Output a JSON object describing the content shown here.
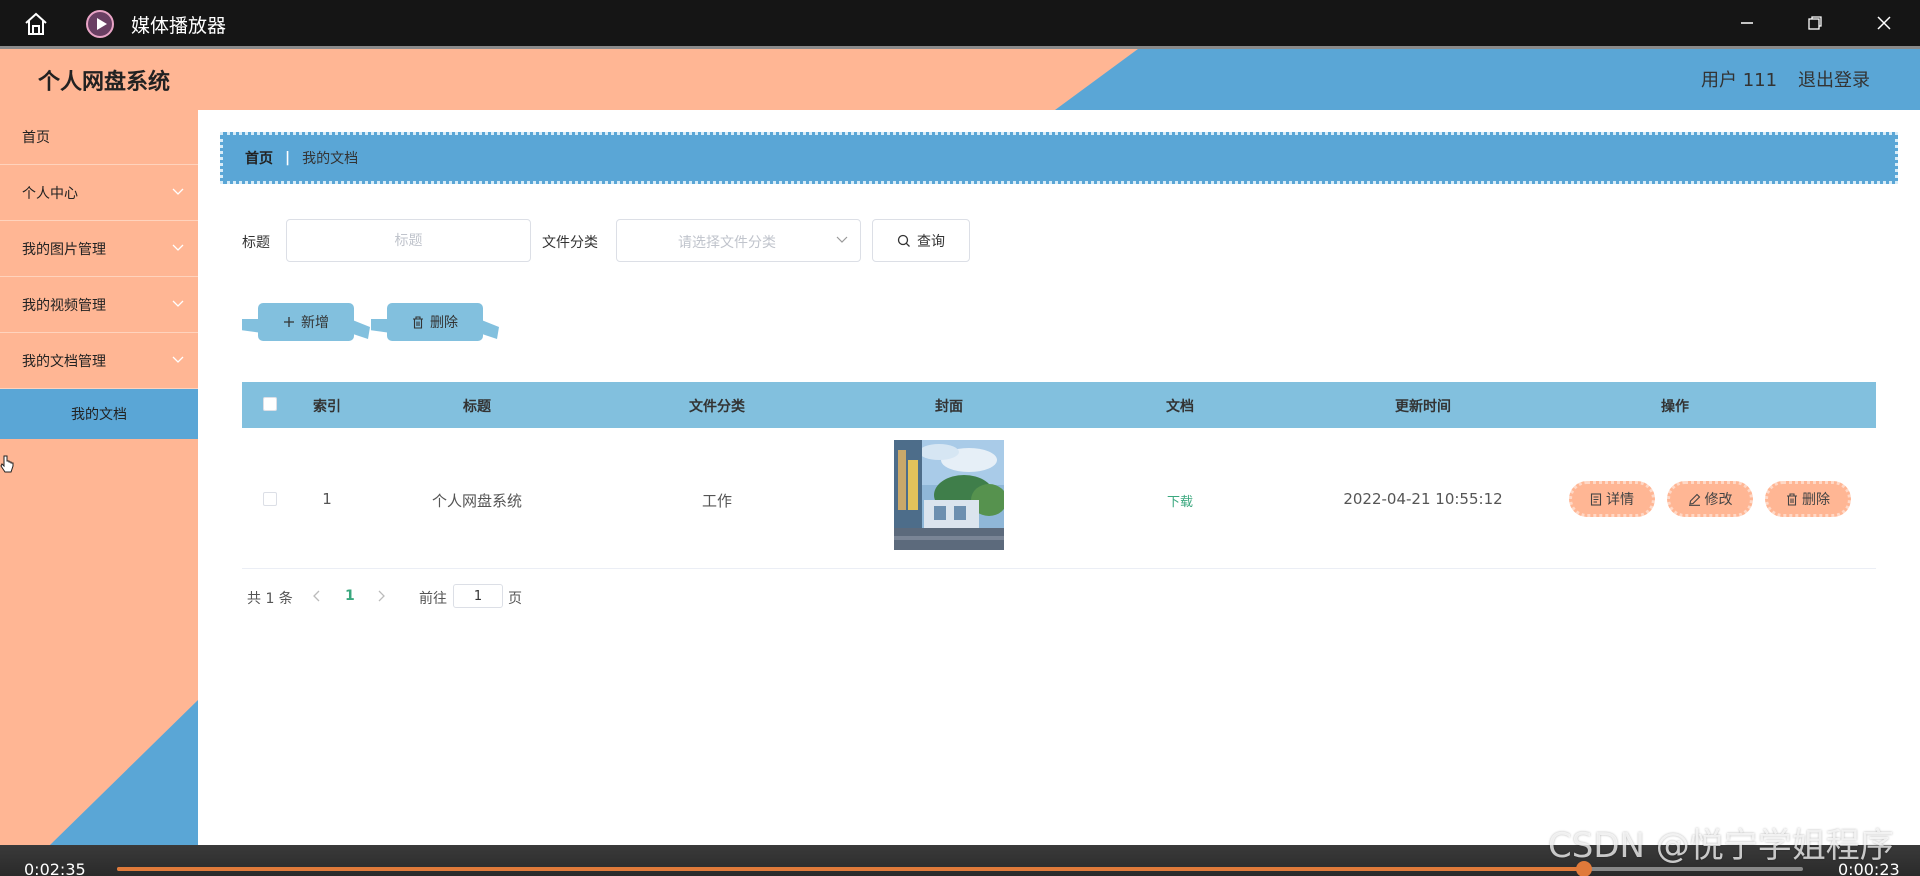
{
  "player": {
    "window_title": "媒体播放器",
    "elapsed": "0:02:35",
    "remaining": "0:00:23",
    "progress": 0.87,
    "watermark": "CSDN @悦宁学姐程序"
  },
  "header": {
    "app_title": "个人网盘系统",
    "user": "用户 111",
    "logout": "退出登录"
  },
  "sidebar": {
    "items": [
      {
        "label": "首页",
        "has_chevron": false
      },
      {
        "label": "个人中心",
        "has_chevron": true
      },
      {
        "label": "我的图片管理",
        "has_chevron": true
      },
      {
        "label": "我的视频管理",
        "has_chevron": true
      },
      {
        "label": "我的文档管理",
        "has_chevron": true
      }
    ],
    "active_sub": "我的文档"
  },
  "breadcrumb": {
    "home": "首页",
    "separator": "|",
    "current": "我的文档"
  },
  "search": {
    "title_label": "标题",
    "title_placeholder": "标题",
    "category_label": "文件分类",
    "category_placeholder": "请选择文件分类",
    "query_button": "查询"
  },
  "actions": {
    "add": "新增",
    "delete": "删除"
  },
  "table": {
    "headers": [
      "索引",
      "标题",
      "文件分类",
      "封面",
      "文档",
      "更新时间",
      "操作"
    ],
    "rows": [
      {
        "index": "1",
        "title": "个人网盘系统",
        "category": "工作",
        "document": "下载",
        "updated": "2022-04-21 10:55:12",
        "ops": [
          "详情",
          "修改",
          "删除"
        ]
      }
    ]
  },
  "pagination": {
    "total": "共 1 条",
    "current_page": "1",
    "goto_label": "前往",
    "goto_value": "1",
    "page_suffix": "页"
  },
  "colors": {
    "peach": "#ffb694",
    "blue": "#5aa6d6",
    "light_blue": "#82c0de",
    "link_green": "#3aa77e",
    "progress_orange": "#e07a3a"
  }
}
